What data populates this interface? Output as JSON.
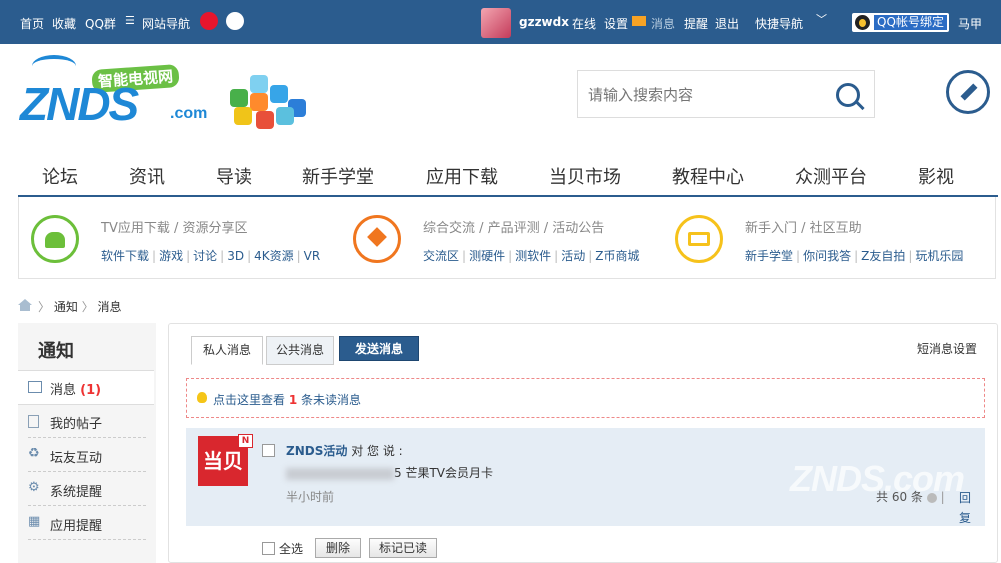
{
  "topbar": {
    "home": "首页",
    "favorite": "收藏",
    "qq_group": "QQ群",
    "site_nav": "网站导航",
    "username": "gzzwdx",
    "online": "在线",
    "settings": "设置",
    "messages": "消息",
    "remind": "提醒",
    "logout": "退出",
    "quick_nav": "快捷导航",
    "qq_bind": "QQ帐号绑定",
    "horse": "马甲"
  },
  "logo": {
    "brand": "ZNDS",
    "domain": ".com",
    "slogan": "智能电视网"
  },
  "search": {
    "placeholder": "请输入搜索内容"
  },
  "mainnav": [
    "论坛",
    "资讯",
    "导读",
    "新手学堂",
    "应用下载",
    "当贝市场",
    "教程中心",
    "众测平台",
    "影视"
  ],
  "categories": [
    {
      "title": "TV应用下载 / 资源分享区",
      "links": [
        "软件下载",
        "游戏",
        "讨论",
        "3D",
        "4K资源",
        "VR"
      ]
    },
    {
      "title": "综合交流 / 产品评测 / 活动公告",
      "links": [
        "交流区",
        "测硬件",
        "测软件",
        "活动",
        "Z币商城"
      ]
    },
    {
      "title": "新手入门 / 社区互助",
      "links": [
        "新手学堂",
        "你问我答",
        "Z友自拍",
        "玩机乐园"
      ]
    }
  ],
  "breadcrumb": {
    "level1": "通知",
    "level2": "消息"
  },
  "sidebar": {
    "title": "通知",
    "items": [
      {
        "label": "消息",
        "count": "(1)"
      },
      {
        "label": "我的帖子"
      },
      {
        "label": "坛友互动"
      },
      {
        "label": "系统提醒"
      },
      {
        "label": "应用提醒"
      }
    ]
  },
  "tabs": {
    "private": "私人消息",
    "public": "公共消息",
    "send": "发送消息",
    "settings": "短消息设置"
  },
  "notice": {
    "prefix": "点击这里查看",
    "count": "1",
    "suffix": "条未读消息"
  },
  "message": {
    "avatar_text": "当贝",
    "avatar_badge": "N",
    "sender": "ZNDS活动",
    "says": "对 您 说 :",
    "body_visible": "5 芒果TV会员月卡",
    "time": "半小时前",
    "count_text": "共 60 条",
    "reply": "回复"
  },
  "watermark": "ZNDS.com",
  "actions": {
    "select_all": "全选",
    "delete": "删除",
    "mark_read": "标记已读"
  },
  "colors": {
    "topbar_bg": "#2b5c8e",
    "accent": "#2b5c8e",
    "unread": "#e33333",
    "send_btn": "#2b5c8e"
  }
}
